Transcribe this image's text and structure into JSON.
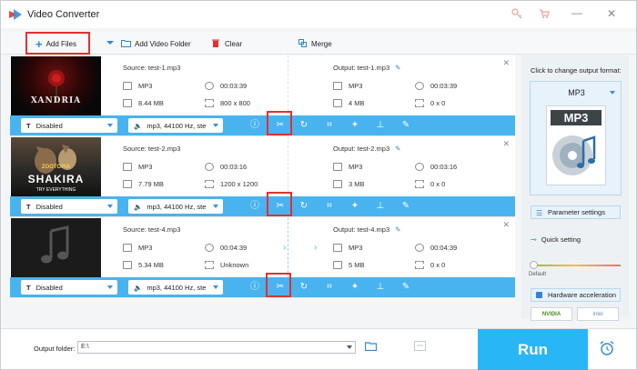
{
  "window": {
    "title": "Video Converter"
  },
  "toolbar": {
    "add_files": "Add Files",
    "add_video_folder": "Add Video Folder",
    "clear": "Clear",
    "merge": "Merge"
  },
  "items": [
    {
      "source": "Source: test-1.mp3",
      "format": "MP3",
      "duration": "00:03:39",
      "size": "8.44 MB",
      "resolution": "800 x 800",
      "output": "Output: test-1.mp3",
      "out_format": "MP3",
      "out_duration": "00:03:39",
      "out_size": "4 MB",
      "out_resolution": "0 x 0",
      "subtitle": "Disabled",
      "audio": "mp3, 44100 Hz, ste",
      "thumb_text": "XANDRIA"
    },
    {
      "source": "Source: test-2.mp3",
      "format": "MP3",
      "duration": "00:03:16",
      "size": "7.79 MB",
      "resolution": "1200 x 1200",
      "output": "Output: test-2.mp3",
      "out_format": "MP3",
      "out_duration": "00:03:16",
      "out_size": "3 MB",
      "out_resolution": "0 x 0",
      "subtitle": "Disabled",
      "audio": "mp3, 44100 Hz, ste",
      "thumb_text": "SHAKIRA",
      "thumb_text2": "ZOOTOPIA",
      "thumb_text3": "TRY EVERYTHING"
    },
    {
      "source": "Source: test-4.mp3",
      "format": "MP3",
      "duration": "00:04:39",
      "size": "5.34 MB",
      "resolution": "Unknown",
      "output": "Output: test-4.mp3",
      "out_format": "MP3",
      "out_duration": "00:04:39",
      "out_size": "5 MB",
      "out_resolution": "0 x 0",
      "subtitle": "Disabled",
      "audio": "mp3, 44100 Hz, ste"
    }
  ],
  "right_panel": {
    "hint": "Click to change output format:",
    "format": "MP3",
    "format_icon_text": "MP3",
    "parameter_settings": "Parameter settings",
    "quick_setting": "Quick setting",
    "default_label": "Default",
    "hardware_acceleration": "Hardware acceleration",
    "nvidia": "NVIDIA",
    "intel": "Intel"
  },
  "bottom": {
    "output_folder_label": "Output folder:",
    "output_folder_value": "E:\\",
    "run": "Run"
  },
  "colors": {
    "accent": "#29b6f6",
    "bar": "#49b3ef",
    "highlight": "#e03131"
  }
}
